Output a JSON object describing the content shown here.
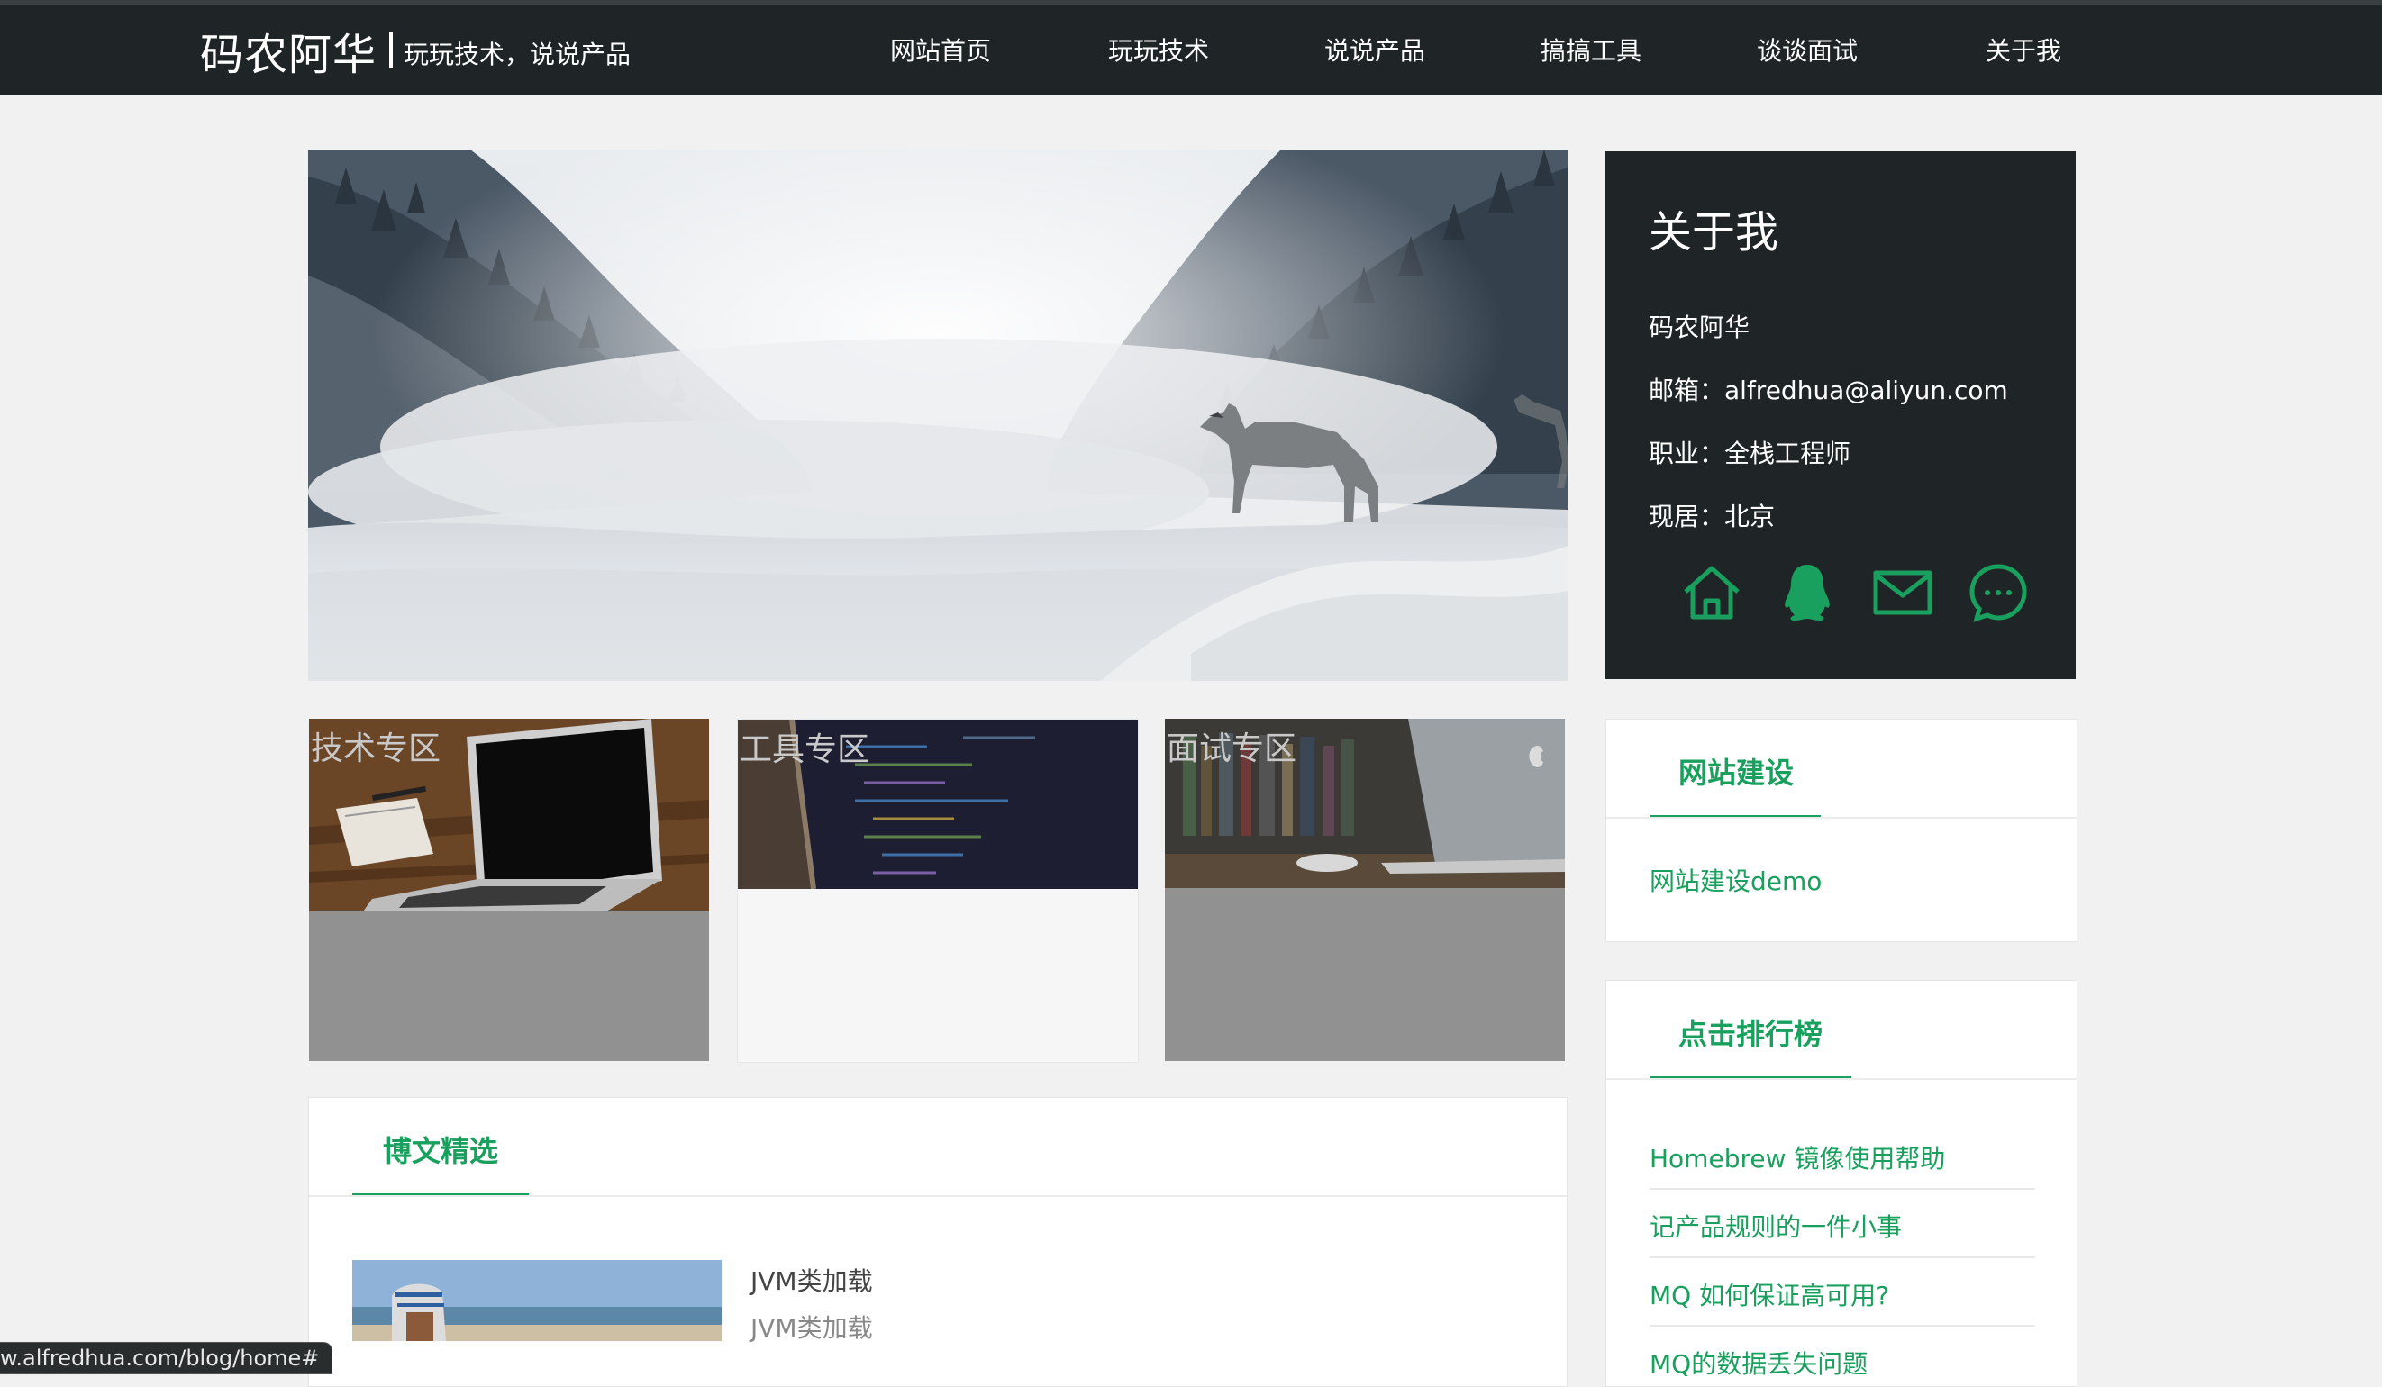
{
  "header": {
    "site_name": "码农阿华",
    "slogan": "玩玩技术，说说产品",
    "nav": [
      "网站首页",
      "玩玩技术",
      "说说产品",
      "搞搞工具",
      "谈谈面试",
      "关于我"
    ]
  },
  "about": {
    "title": "关于我",
    "name": "码农阿华",
    "email": "邮箱：alfredhua@aliyun.com",
    "job": "职业：全栈工程师",
    "location": "现居：北京",
    "icons": [
      "home-icon",
      "qq-icon",
      "mail-icon",
      "chat-icon"
    ]
  },
  "categories": [
    "技术专区",
    "工具专区",
    "面试专区"
  ],
  "featured": {
    "title": "博文精选",
    "posts": [
      {
        "title": "JVM类加载",
        "summary": "JVM类加载"
      }
    ]
  },
  "site_building": {
    "title": "网站建设",
    "items": [
      "网站建设demo"
    ]
  },
  "ranking": {
    "title": "点击排行榜",
    "items": [
      "Homebrew 镜像使用帮助",
      "记产品规则的一件小事",
      "MQ  如何保证高可用?",
      "MQ的数据丢失问题"
    ]
  },
  "status_bar": {
    "url": "w.alfredhua.com/blog/home#"
  },
  "colors": {
    "accent": "#1aa05e",
    "dark": "#1f2426",
    "background": "#f1f1f1"
  }
}
